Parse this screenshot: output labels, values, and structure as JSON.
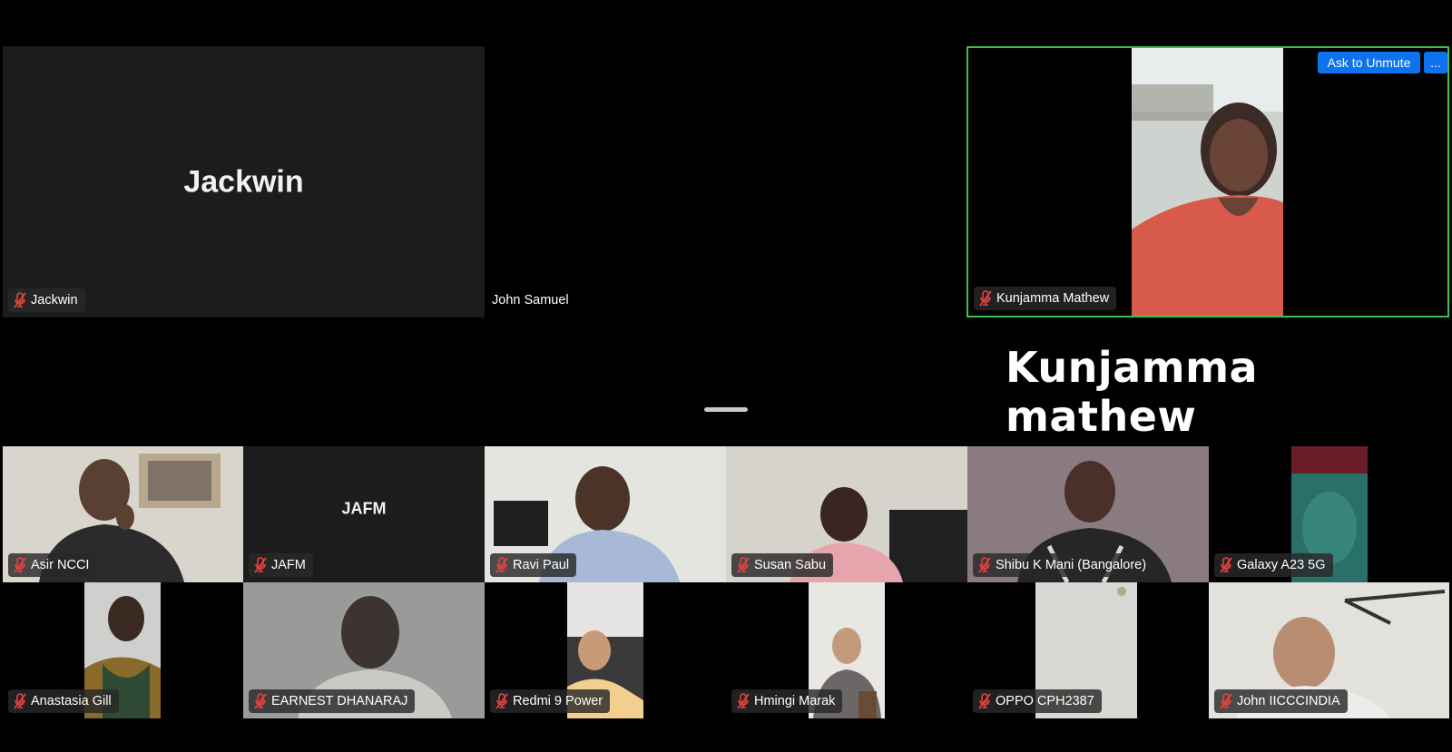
{
  "top_row": {
    "jackwin": {
      "display_name": "Jackwin",
      "label": "Jackwin"
    },
    "john_samuel": {
      "label": "John Samuel"
    },
    "kunjamma": {
      "label": "Kunjamma Mathew",
      "ask_unmute": "Ask to Unmute",
      "more": "..."
    }
  },
  "caption": "Kunjamma mathew",
  "grid": [
    {
      "label": "Asir NCCI",
      "muted": true
    },
    {
      "label": "JAFM",
      "display_name": "JAFM",
      "muted": true
    },
    {
      "label": "Ravi Paul",
      "muted": true
    },
    {
      "label": "Susan Sabu",
      "muted": true
    },
    {
      "label": "Shibu K Mani (Bangalore)",
      "muted": true
    },
    {
      "label": "Galaxy A23 5G",
      "muted": true
    },
    {
      "label": "Anastasia Gill",
      "muted": true
    },
    {
      "label": "EARNEST DHANARAJ",
      "muted": true
    },
    {
      "label": "Redmi 9 Power",
      "muted": true
    },
    {
      "label": "Hmingi Marak",
      "muted": true
    },
    {
      "label": "OPPO CPH2387",
      "muted": true
    },
    {
      "label": "John IICCCINDIA",
      "muted": true
    }
  ],
  "colors": {
    "active_border": "#3ec24a",
    "accent": "#0e72ed",
    "muted_icon": "#e8423f"
  },
  "icons": {
    "muted": "mic-muted-icon"
  }
}
